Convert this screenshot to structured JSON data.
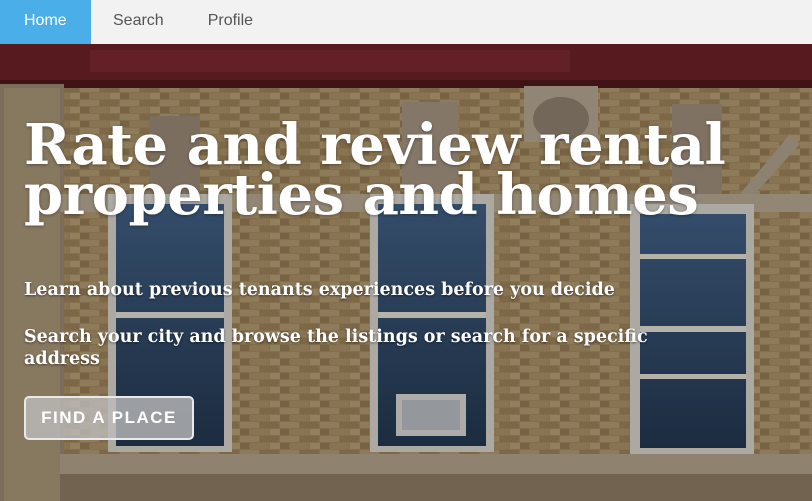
{
  "nav": {
    "items": [
      {
        "label": "Home",
        "active": true
      },
      {
        "label": "Search",
        "active": false
      },
      {
        "label": "Profile",
        "active": false
      }
    ]
  },
  "hero": {
    "headline": "Rate and review rental properties and homes",
    "subtitle1": "Learn about previous tenants experiences before you decide",
    "subtitle2": "Search your city and browse the listings or search for a specific address",
    "cta_label": "FIND A PLACE"
  },
  "colors": {
    "nav_active": "#4aaee8",
    "nav_bg": "#f2f2f2",
    "brick": "#a08a62",
    "cornice": "#6b1f26"
  }
}
